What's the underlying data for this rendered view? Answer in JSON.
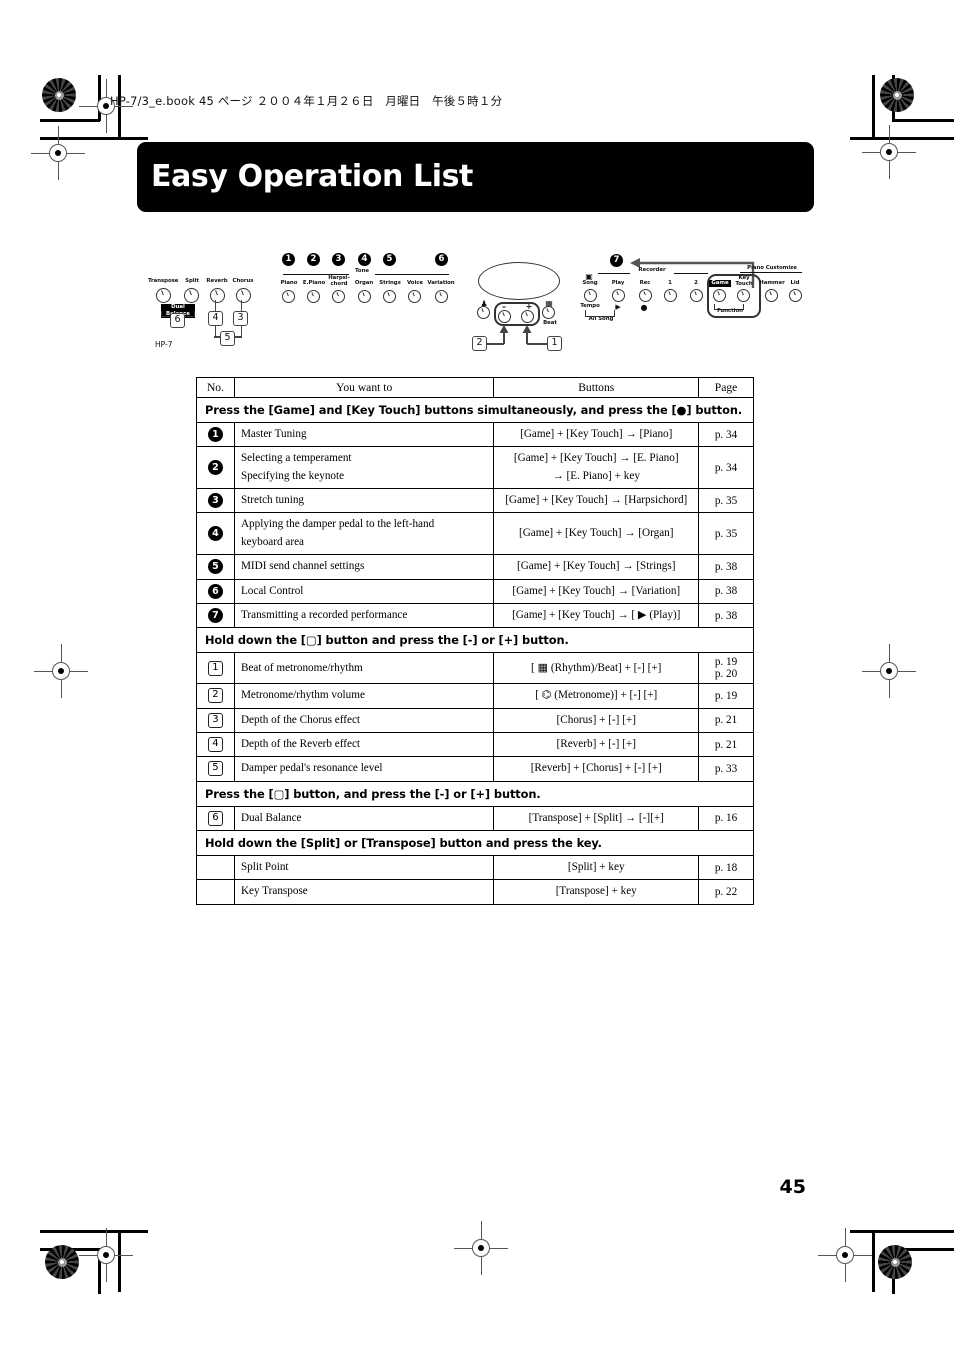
{
  "book": {
    "header_line": "HP-7/3_e.book 45 ページ ２００４年１月２６日　月曜日　午後５時１分",
    "page_number": "45"
  },
  "title": {
    "text": "Easy Operation List"
  },
  "panel": {
    "model": "HP-7",
    "left_knobs": [
      {
        "label": "Transpose"
      },
      {
        "label": "Split"
      },
      {
        "label": "Reverb"
      },
      {
        "label": "Chorus"
      }
    ],
    "dual_balance_label": "Dual Balance",
    "left_callouts": [
      "6",
      "4",
      "3",
      "5"
    ],
    "tone_group_label": "Tone",
    "tone_knobs": [
      {
        "label": "Piano",
        "num": "1"
      },
      {
        "label": "E.Piano",
        "num": "2"
      },
      {
        "label": "Harpsi-\nchord",
        "num": "3"
      },
      {
        "label": "Organ",
        "num": "4"
      },
      {
        "label": "Strings",
        "num": "5"
      },
      {
        "label": "Voice",
        "num": ""
      },
      {
        "label": "Variation",
        "num": "6"
      }
    ],
    "center": {
      "minus": "–",
      "plus": "+",
      "metronome_label": "",
      "beat_label": "Beat",
      "callout_left": "2",
      "callout_right": "1"
    },
    "recorder_group_label": "Recorder",
    "piano_customize_group_label": "Piano Customize",
    "function_group_label": "Function",
    "right_knobs": [
      {
        "label": "Song",
        "sub": "Tempo"
      },
      {
        "label": "Play",
        "sub": ""
      },
      {
        "label": "Rec",
        "sub": ""
      },
      {
        "label": "1",
        "sub": ""
      },
      {
        "label": "2",
        "sub": ""
      },
      {
        "label": "Game",
        "sub": ""
      },
      {
        "label": "Key\nTouch",
        "sub": ""
      },
      {
        "label": "Hammer",
        "sub": ""
      },
      {
        "label": "Lid",
        "sub": ""
      }
    ],
    "all_song_label": "All Song",
    "callout_7": "7"
  },
  "table": {
    "headers": [
      "No.",
      "You want to",
      "Buttons",
      "Page"
    ],
    "sections": [
      {
        "heading": "Press the [Game] and [Key Touch] buttons simultaneously, and press the [●] button.",
        "badge_style": "circle",
        "rows": [
          {
            "no": "1",
            "want": "Master Tuning",
            "buttons": "[Game] + [Key Touch] → [Piano]",
            "page": "p. 34"
          },
          {
            "no": "2",
            "want": "Selecting a temperament\nSpecifying the keynote",
            "buttons": "[Game] + [Key Touch] → [E. Piano]\n→ [E. Piano] + key",
            "page": "p. 34"
          },
          {
            "no": "3",
            "want": "Stretch tuning",
            "buttons": "[Game] + [Key Touch] → [Harpsichord]",
            "page": "p. 35"
          },
          {
            "no": "4",
            "want": "Applying the damper pedal to the left-hand\nkeyboard area",
            "buttons": "[Game] + [Key Touch] → [Organ]",
            "page": "p. 35"
          },
          {
            "no": "5",
            "want": "MIDI send channel settings",
            "buttons": "[Game] + [Key Touch] → [Strings]",
            "page": "p. 38"
          },
          {
            "no": "6",
            "want": "Local Control",
            "buttons": "[Game] + [Key Touch] → [Variation]",
            "page": "p. 38"
          },
          {
            "no": "7",
            "want": "Transmitting a recorded performance",
            "buttons": "[Game] + [Key Touch] → [ ▶ (Play)]",
            "page": "p. 38"
          }
        ]
      },
      {
        "heading": "Hold down the [▢] button and press the [-] or [+] button.",
        "badge_style": "square",
        "rows": [
          {
            "no": "1",
            "want": "Beat of metronome/rhythm",
            "buttons": "[ ▦ (Rhythm)/Beat] + [-] [+]",
            "page": "p. 19\np. 20"
          },
          {
            "no": "2",
            "want": "Metronome/rhythm volume",
            "buttons": "[ ⌬ (Metronome)] + [-] [+]",
            "page": "p. 19"
          },
          {
            "no": "3",
            "want": "Depth of the Chorus effect",
            "buttons": "[Chorus] + [-] [+]",
            "page": "p. 21"
          },
          {
            "no": "4",
            "want": "Depth of the Reverb effect",
            "buttons": "[Reverb] + [-] [+]",
            "page": "p. 21"
          },
          {
            "no": "5",
            "want": "Damper pedal's resonance level",
            "buttons": "[Reverb] + [Chorus] + [-] [+]",
            "page": "p. 33"
          }
        ]
      },
      {
        "heading": "Press the [▢] button, and press the [-] or [+] button.",
        "badge_style": "square",
        "rows": [
          {
            "no": "6",
            "want": "Dual Balance",
            "buttons": "[Transpose] + [Split] → [-][+]",
            "page": "p. 16"
          }
        ]
      },
      {
        "heading": "Hold down the [Split] or [Transpose] button and press the key.",
        "badge_style": "none",
        "rows": [
          {
            "no": "",
            "want": "Split Point",
            "buttons": "[Split] + key",
            "page": "p. 18"
          },
          {
            "no": "",
            "want": "Key Transpose",
            "buttons": "[Transpose] + key",
            "page": "p. 22"
          }
        ]
      }
    ]
  }
}
